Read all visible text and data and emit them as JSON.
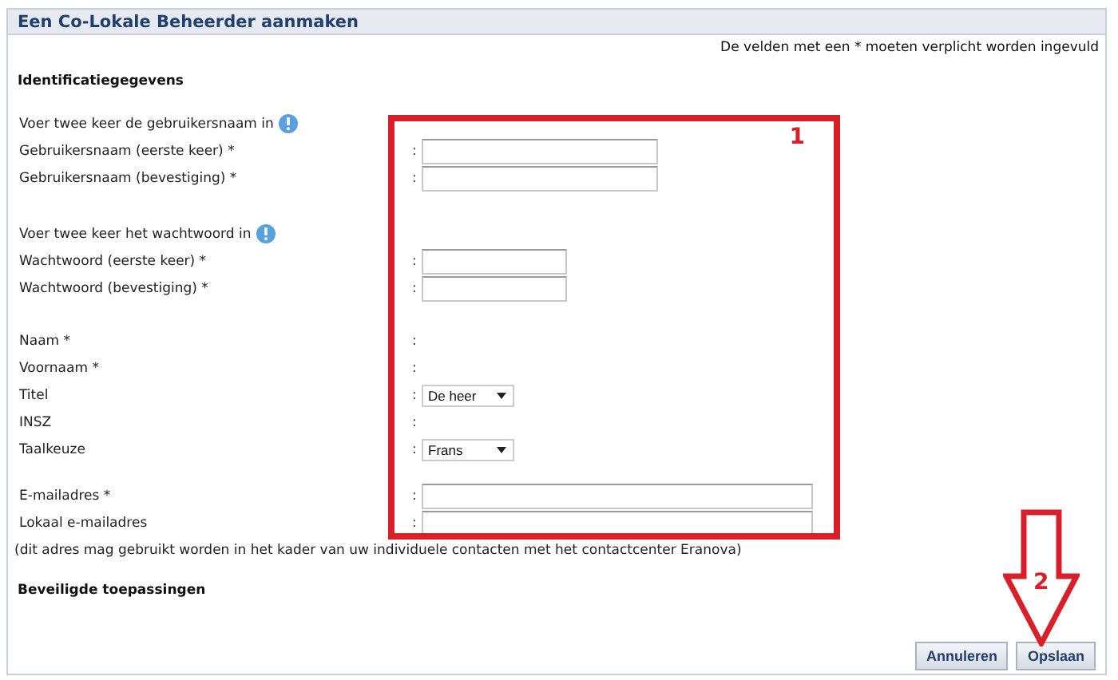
{
  "panel": {
    "title": "Een Co-Lokale Beheerder aanmaken",
    "required_note": "De velden met een * moeten verplicht worden ingevuld"
  },
  "section": {
    "title": "Identificatiegegevens"
  },
  "groups": [
    {
      "kind": "credentials",
      "intro": "Voer twee keer de gebruikersnaam in",
      "rows": [
        {
          "kind": "input",
          "label": "Gebruikersnaam (eerste keer) *",
          "separator": ":"
        },
        {
          "kind": "input",
          "label": "Gebruikersnaam (bevestiging) *",
          "separator": ":"
        }
      ]
    },
    {
      "kind": "password",
      "intro": "Voer twee keer het wachtwoord in",
      "rows": [
        {
          "kind": "input",
          "label": "Wachtwoord (eerste keer) *",
          "separator": ":"
        },
        {
          "kind": "input",
          "label": "Wachtwoord (bevestiging) *",
          "separator": ":"
        }
      ]
    },
    {
      "rows": [
        {
          "kind": "text",
          "label": "Naam *",
          "separator": ":"
        },
        {
          "kind": "text",
          "label": "Voornaam *",
          "separator": ":"
        },
        {
          "kind": "select",
          "label": "Titel",
          "separator": ":",
          "value": "De heer"
        },
        {
          "kind": "text",
          "label": "INSZ",
          "separator": ":"
        },
        {
          "kind": "select",
          "label": "Taalkeuze",
          "separator": ":",
          "value": "Frans"
        }
      ]
    },
    {
      "kind": "contact",
      "rows": [
        {
          "kind": "input",
          "label": "E-mailadres *",
          "separator": ":"
        },
        {
          "kind": "input",
          "label": "Lokaal e-mailadres",
          "separator": ":"
        }
      ],
      "note": "(dit adres mag gebruikt worden in het kader van uw individuele contacten met het contactcenter Eranova)"
    }
  ],
  "section_2": {
    "title": "Beveiligde toepassingen"
  },
  "buttons": [
    "Annuleren",
    "Opslaan"
  ],
  "annotations": [
    {
      "kind": "box",
      "label": "1"
    },
    {
      "kind": "arrow",
      "label": "2"
    }
  ]
}
